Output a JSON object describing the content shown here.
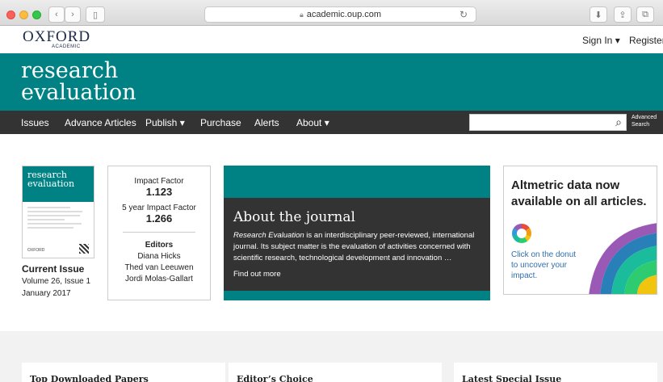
{
  "browser": {
    "url": "academic.oup.com"
  },
  "header": {
    "logo": "OXFORD",
    "logo_sub": "ACADEMIC",
    "sign_in": "Sign In ▾",
    "register": "Register"
  },
  "journal": {
    "title_line1": "research",
    "title_line2": "evaluation"
  },
  "nav": {
    "items": [
      "Issues",
      "Advance Articles",
      "Publish ▾",
      "Purchase",
      "Alerts",
      "About ▾"
    ],
    "advanced_line1": "Advanced",
    "advanced_line2": "Search"
  },
  "current_issue": {
    "cover_line1": "research",
    "cover_line2": "evaluation",
    "cover_foot": "OXFORD",
    "label": "Current Issue",
    "volume": "Volume 26, Issue 1",
    "date": "January 2017"
  },
  "impact": {
    "if_label": "Impact Factor",
    "if_value": "1.123",
    "five_label": "5 year Impact Factor",
    "five_value": "1.266",
    "editors_label": "Editors",
    "editors": [
      "Diana Hicks",
      "Thed van Leeuwen",
      "Jordi Molas-Gallart"
    ]
  },
  "about": {
    "heading": "About the journal",
    "desc_em": "Research Evaluation",
    "desc_rest": " is an interdisciplinary peer-reviewed, international journal. Its subject matter is the evaluation of activities concerned with scientific research, technological development and innovation …",
    "more": "Find out more"
  },
  "altmetric": {
    "heading": "Altmetric data now available on all articles.",
    "click": "Click on the donut to uncover your impact."
  },
  "lower": {
    "cards": [
      "Top Downloaded Papers",
      "Editor’s Choice",
      "Latest Special Issue"
    ]
  },
  "colors": {
    "teal": "#008284",
    "dark": "#333333",
    "link": "#2f6fae"
  }
}
